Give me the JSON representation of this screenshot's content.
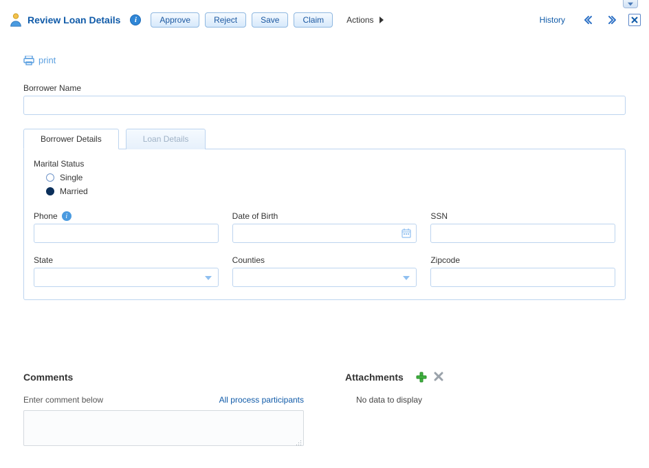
{
  "toolbar": {
    "title": "Review Loan Details",
    "approve": "Approve",
    "reject": "Reject",
    "save": "Save",
    "claim": "Claim",
    "actions": "Actions",
    "history": "History"
  },
  "print": {
    "label": "print"
  },
  "form": {
    "borrower_name": {
      "label": "Borrower Name",
      "value": ""
    },
    "tabs": {
      "borrower_details": "Borrower Details",
      "loan_details": "Loan Details"
    },
    "marital_status": {
      "label": "Marital Status",
      "options": {
        "single": "Single",
        "married": "Married"
      },
      "selected": "married"
    },
    "phone": {
      "label": "Phone",
      "value": ""
    },
    "dob": {
      "label": "Date of Birth",
      "value": ""
    },
    "ssn": {
      "label": "SSN",
      "value": ""
    },
    "state": {
      "label": "State",
      "value": ""
    },
    "counties": {
      "label": "Counties",
      "value": ""
    },
    "zipcode": {
      "label": "Zipcode",
      "value": ""
    }
  },
  "comments": {
    "heading": "Comments",
    "prompt": "Enter comment below",
    "participants": "All process participants",
    "value": ""
  },
  "attachments": {
    "heading": "Attachments",
    "nodata": "No data to display"
  }
}
